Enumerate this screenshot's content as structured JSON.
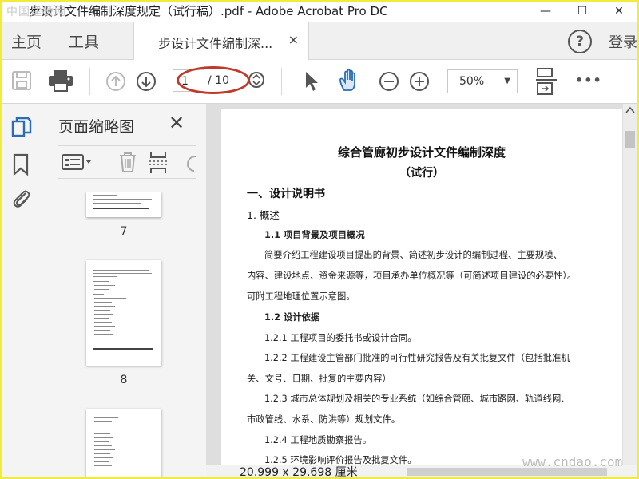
{
  "window": {
    "watermark_top": "中国建桥网",
    "title": "步设计文件编制深度规定（试行稿）.pdf - Adobe Acrobat Pro DC",
    "min": "—",
    "max": "☐",
    "close": "✕"
  },
  "tabs": {
    "home": "主页",
    "tools": "工具",
    "doc_tab": "步设计文件编制深...",
    "doc_close": "×",
    "help": "?",
    "login": "登录"
  },
  "toolbar": {
    "page_current": "1",
    "page_total": "/ 10",
    "zoom": "50%",
    "more": "•••"
  },
  "thumbnails": {
    "title": "页面缩略图",
    "close": "✕",
    "pages": [
      {
        "label": "7"
      },
      {
        "label": "8"
      }
    ]
  },
  "document": {
    "title": "综合管廊初步设计文件编制深度",
    "subtitle": "（试行）",
    "lines": [
      {
        "text": "一、设计说明书"
      },
      {
        "text": "1. 概述"
      },
      {
        "text": "1.1 项目背景及项目概况"
      },
      {
        "text": "简要介绍工程建设项目提出的背景、简述初步设计的编制过程、主要规模、"
      },
      {
        "text": "内容、建设地点、资金来源等，项目承办单位概况等（可简述项目建设的必要性）。"
      },
      {
        "text": "可附工程地理位置示意图。"
      },
      {
        "text": "1.2 设计依据"
      },
      {
        "text": "1.2.1 工程项目的委托书或设计合同。"
      },
      {
        "text": "1.2.2 工程建设主管部门批准的可行性研究报告及有关批复文件（包括批准机"
      },
      {
        "text": "关、文号、日期、批复的主要内容）"
      },
      {
        "text": "1.2.3 城市总体规划及相关的专业系统（如综合管廊、城市路网、轨道线网、"
      },
      {
        "text": "市政管线、水系、防洪等）规划文件。"
      },
      {
        "text": "1.2.4 工程地质勘察报告。"
      },
      {
        "text": "1.2.5 环境影响评价报告及批复文件。"
      }
    ]
  },
  "status": {
    "page_size": "20.999 x 29.698 厘米"
  },
  "watermark_bottom": "www.cndao.com",
  "colors": {
    "frame": "#f1ec3c",
    "annotation": "#c0392b",
    "icon": "#555555"
  }
}
